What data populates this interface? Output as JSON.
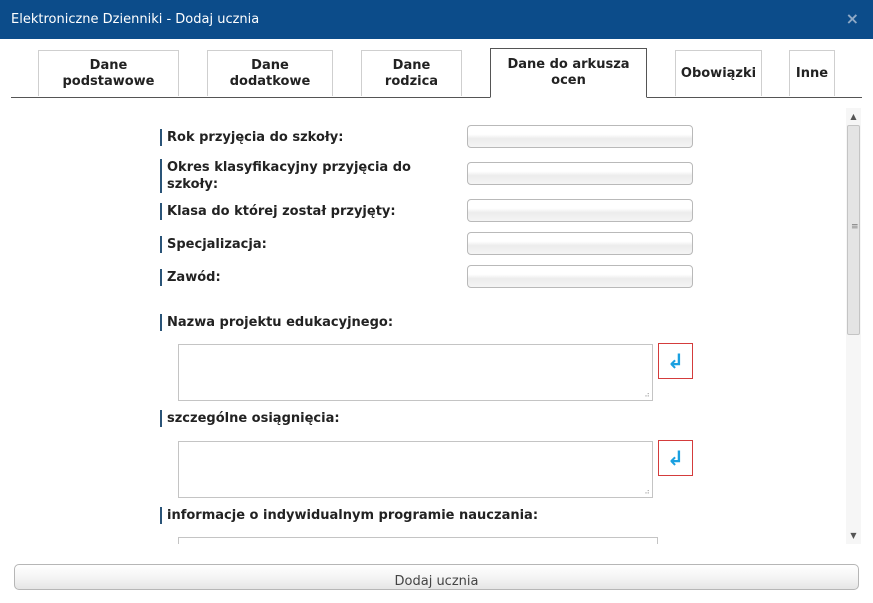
{
  "window": {
    "title": "Elektroniczne Dzienniki - Dodaj ucznia",
    "close_glyph": "×"
  },
  "tabs": [
    {
      "label_line1": "Dane",
      "label_line2": "podstawowe"
    },
    {
      "label_line1": "Dane",
      "label_line2": "dodatkowe"
    },
    {
      "label_line1": "Dane",
      "label_line2": "rodzica"
    },
    {
      "label_line1": "Dane do arkusza",
      "label_line2": "ocen",
      "active": true
    },
    {
      "label_line1": "Obowiązki",
      "label_line2": ""
    },
    {
      "label_line1": "Inne",
      "label_line2": ""
    }
  ],
  "form": {
    "fields": [
      {
        "label": "Rok przyjęcia do szkoły:",
        "value": ""
      },
      {
        "label": "Okres klasyfikacyjny przyjęcia do szkoły:",
        "value": ""
      },
      {
        "label": "Klasa do której został przyjęty:",
        "value": ""
      },
      {
        "label": "Specjalizacja:",
        "value": ""
      },
      {
        "label": "Zawód:",
        "value": ""
      }
    ],
    "textareas": [
      {
        "label": "Nazwa projektu edukacyjnego:",
        "value": ""
      },
      {
        "label": "szczególne osiągnięcia:",
        "value": ""
      },
      {
        "label": "informacje o indywidualnym programie nauczania:",
        "value": ""
      }
    ],
    "enter_icon": "↲",
    "resize_glyph": "⠴"
  },
  "scrollbar": {
    "up": "▲",
    "down": "▼",
    "grip": "≡"
  },
  "footer": {
    "submit_label": "Dodaj ucznia"
  }
}
